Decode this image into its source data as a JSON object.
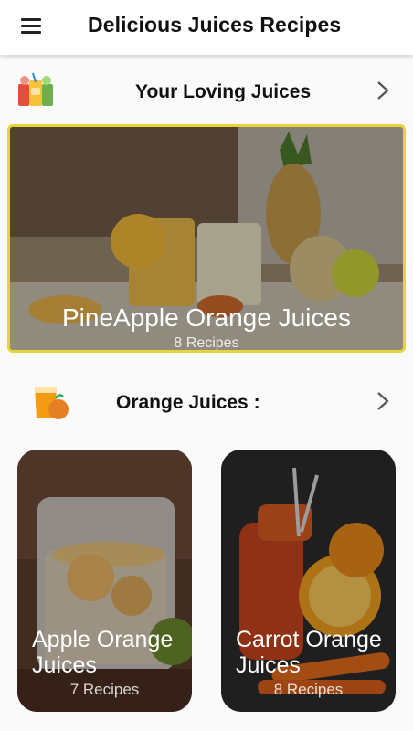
{
  "app": {
    "title": "Delicious Juices Recipes"
  },
  "icons": {
    "menu": "hamburger-menu-icon",
    "chevron": "chevron-right-icon"
  },
  "sections": [
    {
      "title": "Your Loving Juices",
      "icon": "mixed-juices-icon"
    },
    {
      "title": "Orange Juices :",
      "icon": "orange-juice-glass-icon"
    }
  ],
  "featured": {
    "title": "PineApple Orange Juices",
    "count": "8 Recipes"
  },
  "cards": [
    {
      "title": "Apple Orange\nJuices",
      "count": "7 Recipes"
    },
    {
      "title": "Carrot Orange\nJuices",
      "count": "8 Recipes"
    }
  ],
  "colors": {
    "highlight_border": "#e9d33a",
    "appbar": "#ffffff",
    "background": "#fafafa"
  }
}
